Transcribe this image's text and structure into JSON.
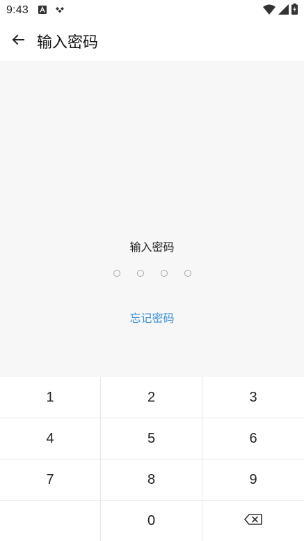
{
  "status_bar": {
    "time": "9:43",
    "icons": [
      "android-a-icon",
      "diamond-icon",
      "wifi-icon",
      "signal-icon",
      "battery-icon"
    ]
  },
  "app_bar": {
    "title": "输入密码",
    "back_icon": "arrow-left-icon"
  },
  "content": {
    "prompt": "输入密码",
    "pin_length": 4,
    "forgot_link": "忘记密码",
    "link_color": "#3d8fd6",
    "background": "#f7f7f7"
  },
  "keypad": {
    "keys": [
      "1",
      "2",
      "3",
      "4",
      "5",
      "6",
      "7",
      "8",
      "9",
      "",
      "0",
      "backspace"
    ],
    "backspace_icon": "backspace-icon"
  }
}
